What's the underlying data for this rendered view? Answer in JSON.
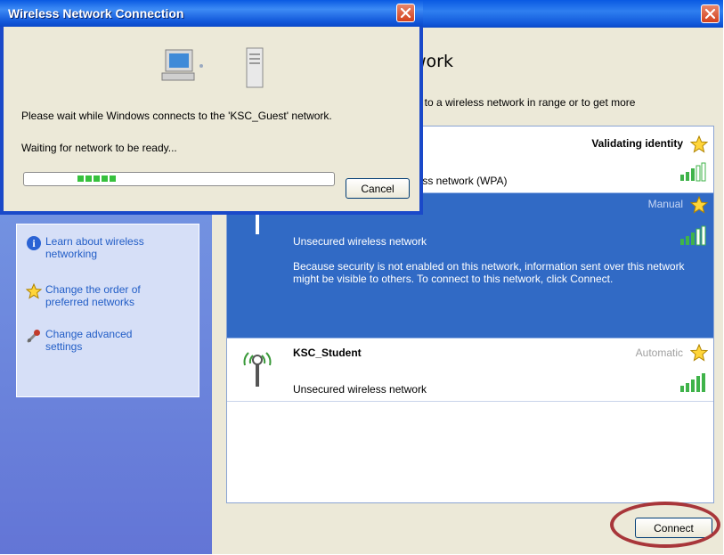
{
  "dialog": {
    "title": "Wireless Network Connection",
    "message": "Please wait while Windows connects to the 'KSC_Guest' network.",
    "status": "Waiting for network to be ready...",
    "progress_blocks": 5,
    "cancel_label": "Cancel"
  },
  "background": {
    "heading_fragment": "work",
    "description_fragment": "ct to a wireless network in range or to get more",
    "tasks": [
      {
        "label": "Learn about wireless networking",
        "icon": "info-icon"
      },
      {
        "label": "Change the order of preferred networks",
        "icon": "star-icon"
      },
      {
        "label": "Change advanced settings",
        "icon": "wrench-icon"
      }
    ],
    "networks": [
      {
        "name": "",
        "status": "Validating identity",
        "security": "less network (WPA)",
        "signal_bars": 4
      },
      {
        "name": "",
        "status": "Manual",
        "security": "Unsecured wireless network",
        "signal_bars": 3,
        "warning": "Because security is not enabled on this network, information sent over this network might be visible to others. To connect to this network, click Connect."
      },
      {
        "name": "KSC_Student",
        "status": "Automatic",
        "security": "Unsecured wireless network",
        "signal_bars": 5
      }
    ],
    "connect_label": "Connect"
  },
  "colors": {
    "title_blue": "#0a5ae2",
    "selection_blue": "#316ac5",
    "task_link": "#215dc6",
    "highlight_ring": "#a8363a"
  }
}
